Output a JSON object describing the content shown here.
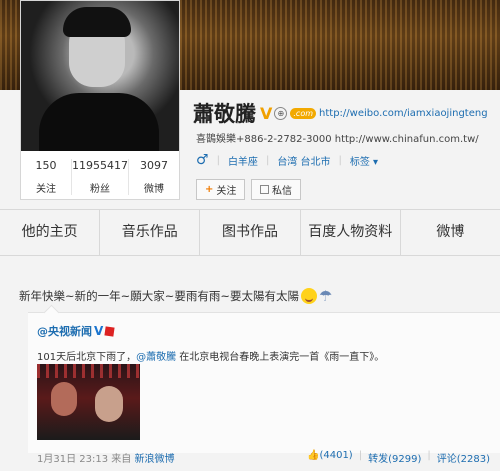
{
  "profile": {
    "name": "蕭敬騰",
    "verified_mark": "V",
    "circle_badge": "⊕",
    "com_badge": ".com",
    "weibo_url": "http://weibo.com/iamxiaojingteng",
    "contact": "喜鵲娛樂+886-2-2782-3000",
    "website": "http://www.chinafun.com.tw/",
    "gender_symbol": "♂",
    "constellation": "白羊座",
    "location": "台湾 台北市",
    "tags_label": "标签 ▾",
    "follow_label": "关注",
    "message_label": "私信"
  },
  "stats": [
    {
      "num": "150",
      "label": "关注"
    },
    {
      "num": "11955417",
      "label": "粉丝"
    },
    {
      "num": "3097",
      "label": "微博"
    }
  ],
  "tabs": [
    "他的主页",
    "音乐作品",
    "图书作品",
    "百度人物资料",
    "微博"
  ],
  "post": {
    "text": "新年快樂~新的一年~願大家~要雨有雨~要太陽有太陽",
    "retweet": {
      "author": "@央视新闻",
      "text_before": "101天后北京下雨了，",
      "mention": "@蕭敬騰",
      "text_after": " 在北京电视台春晚上表演完一首《雨一直下》。"
    },
    "meta": {
      "date": "1月31日 23:13",
      "from": "来自",
      "source": "新浪微博"
    },
    "actions": {
      "likes": "(4401)",
      "repost": "转发(9299)",
      "comment": "评论(2283)"
    }
  },
  "colors": {
    "link": "#1d6db0",
    "accent": "#f07a00"
  }
}
